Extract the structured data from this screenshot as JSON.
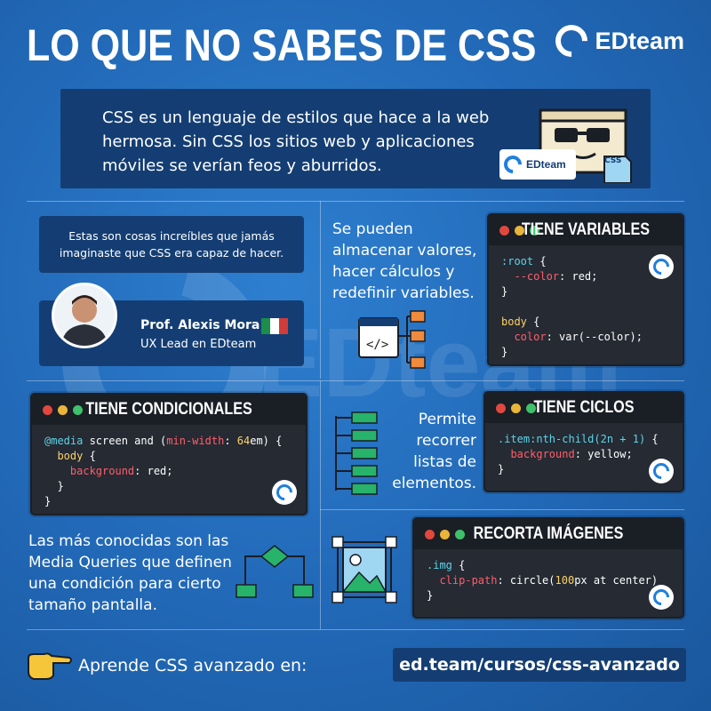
{
  "header": {
    "title": "LO QUE NO SABES DE CSS",
    "brand": "EDteam"
  },
  "intro": {
    "text": "CSS es un lenguaje de estilos que hace a la web hermosa. Sin CSS los sitios web y aplicaciones móviles se verían feos y aburridos.",
    "card_label": "EDteam",
    "file_badge": "CSS"
  },
  "watermark": "EDteam",
  "quote": "Estas son cosas increíbles que jamás imaginaste que CSS era capaz de hacer.",
  "author": {
    "name": "Prof. Alexis Mora",
    "role": "UX Lead en EDteam"
  },
  "variables": {
    "text": "Se pueden almacenar valores, hacer cálculos y redefinir variables.",
    "card_title": "TIENE VARIABLES"
  },
  "conditionals": {
    "card_title": "TIENE CONDICIONALES",
    "text": "Las más conocidas son las Media Queries que definen una condición para cierto tamaño pantalla."
  },
  "loops": {
    "text": "Permite recorrer listas de elementos.",
    "card_title": "TIENE CICLOS"
  },
  "clip": {
    "card_title": "RECORTA IMÁGENES"
  },
  "cta": {
    "text": "Aprende CSS avanzado en:",
    "link": "ed.team/cursos/css-avanzado"
  },
  "colors": {
    "background": "#2168b6",
    "panel": "#143e73",
    "code_bg": "#252a33",
    "dot_red": "#e0483e",
    "dot_yellow": "#e8b53a",
    "dot_green": "#3ec16a",
    "icon_green": "#27b36a"
  }
}
